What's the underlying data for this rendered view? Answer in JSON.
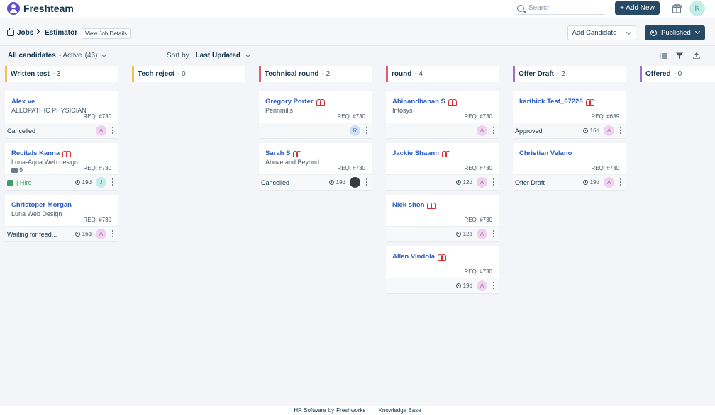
{
  "app": {
    "name": "Freshteam"
  },
  "topbar": {
    "search_placeholder": "Search",
    "add_new_label": "+ Add New",
    "avatar_initial": "K"
  },
  "breadcrumb": {
    "jobs": "Jobs",
    "job": "Estimator",
    "view_job_details": "View Job Details"
  },
  "actions": {
    "add_candidate": "Add Candidate",
    "published": "Published"
  },
  "filters": {
    "all_candidates": "All candidates",
    "status": "- Active",
    "count": "(46)",
    "sort_by_label": "Sort by",
    "sort_by_value": "Last Updated"
  },
  "colors": {
    "written": "#f2c14e",
    "tech_reject": "#f2c14e",
    "technical": "#e35d6a",
    "round": "#e35d6a",
    "offer_draft": "#a070c8",
    "offered": "#a070c8",
    "link": "#2c5cc5",
    "primary": "#264966"
  },
  "columns": [
    {
      "name": "Written test",
      "count": "- 3"
    },
    {
      "name": "Tech reject",
      "count": "- 0"
    },
    {
      "name": "Technical round",
      "count": "- 2"
    },
    {
      "name": "round",
      "count": "- 4"
    },
    {
      "name": "Offer Draft",
      "count": "- 2"
    },
    {
      "name": "Offered",
      "count": "- 0"
    }
  ],
  "cards": {
    "c0_0": {
      "name": "Alex ve",
      "company": "ALLOPATHIC PHYSICIAN",
      "req": "REQ: #730",
      "status": "Cancelled",
      "avatar": "A"
    },
    "c0_1": {
      "name": "Recitals Kanna",
      "company": "Luna-Aqua Web design",
      "mail_count": "9",
      "req": "REQ: #730",
      "status": "| Hire",
      "days": "19d",
      "avatar": "J"
    },
    "c0_2": {
      "name": "Christoper Morgan",
      "company": "Luna Web Design",
      "req": "REQ: #730",
      "status": "Waiting for feed...",
      "days": "16d",
      "avatar": "A"
    },
    "c2_0": {
      "name": "Gregory Porter",
      "company": "Pennmills",
      "req": "REQ: #730",
      "avatar": "R"
    },
    "c2_1": {
      "name": "Sarah S",
      "company": "Above and Beyond",
      "req": "REQ: #730",
      "status": "Cancelled",
      "days": "19d"
    },
    "c3_0": {
      "name": "Abinandhanan S",
      "company": "Infosys",
      "req": "REQ: #730",
      "avatar": "A"
    },
    "c3_1": {
      "name": "Jackie Shaann",
      "req": "REQ: #730",
      "days": "12d",
      "avatar": "A"
    },
    "c3_2": {
      "name": "Nick shon",
      "req": "REQ: #730",
      "days": "12d",
      "avatar": "A"
    },
    "c3_3": {
      "name": "Allen Vindola",
      "req": "REQ: #730",
      "days": "19d",
      "avatar": "A"
    },
    "c4_0": {
      "name": "karthick Test_67228",
      "req": "REQ: #639",
      "status": "Approved",
      "days": "16d",
      "avatar": "A"
    },
    "c4_1": {
      "name": "Christian Velano",
      "req": "REQ: #730",
      "status": "Offer Draft",
      "days": "19d",
      "avatar": "A"
    }
  },
  "footer": {
    "hr": "HR Software",
    "by": "by",
    "freshworks": "Freshworks",
    "separator": "|",
    "kb": "Knowledge Base"
  }
}
